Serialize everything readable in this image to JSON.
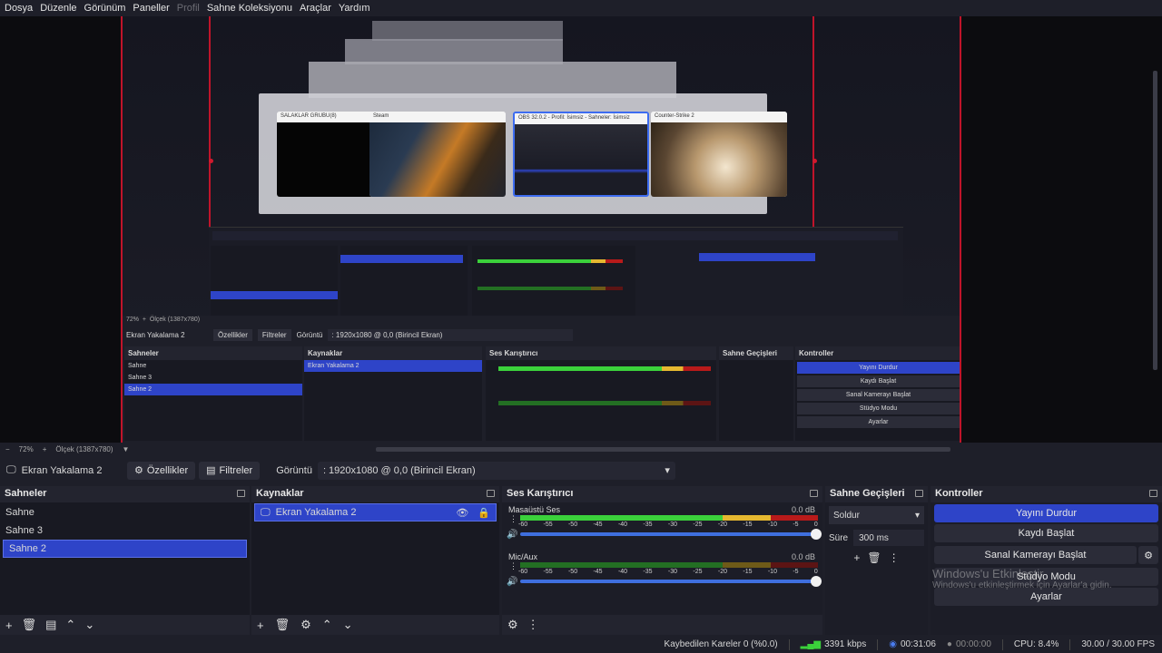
{
  "menu": [
    "Dosya",
    "Düzenle",
    "Görünüm",
    "Paneller",
    "Profil",
    "Sahne Koleksiyonu",
    "Araçlar",
    "Yardım"
  ],
  "preview": {
    "switcher_windows": [
      {
        "title": "SALAKLAR GRUBU(8)"
      },
      {
        "title": "Steam"
      },
      {
        "title": "OBS 32.0.2 - Profil: İsimsiz - Sahneler: İsimsiz"
      },
      {
        "title": "Counter-Strike 2"
      }
    ],
    "mid_obs": {
      "source_name": "Ekran Yakalama 2",
      "props_label": "Özellikler",
      "filters_label": "Filtreler",
      "view_label": "Görüntü",
      "view_value": ": 1920x1080 @ 0,0 (Birincil Ekran)",
      "scenes_title": "Sahneler",
      "scenes": [
        "Sahne",
        "Sahne 3",
        "Sahne 2"
      ],
      "sources_title": "Kaynaklar",
      "mixer_title": "Ses Karıştırıcı",
      "transitions_title": "Sahne Geçişleri",
      "controls_title": "Kontroller",
      "stop_stream": "Yayını Durdur",
      "start_rec": "Kaydı Başlat",
      "virtual_cam": "Sanal Kamerayı Başlat",
      "studio": "Stüdyo Modu",
      "settings": "Ayarlar",
      "zoom": "72%",
      "scale": "Ölçek (1387x780)"
    }
  },
  "toolbar": {
    "zoom": "72%",
    "scale": "Ölçek (1387x780)"
  },
  "source_bar": {
    "name": "Ekran Yakalama 2",
    "props": "Özellikler",
    "filters": "Filtreler",
    "view_label": "Görüntü",
    "view_value": ": 1920x1080 @ 0,0 (Birincil Ekran)"
  },
  "scenes": {
    "title": "Sahneler",
    "items": [
      "Sahne",
      "Sahne 3",
      "Sahne 2"
    ],
    "active_index": 2
  },
  "sources": {
    "title": "Kaynaklar",
    "items": [
      "Ekran Yakalama 2"
    ]
  },
  "mixer": {
    "title": "Ses Karıştırıcı",
    "channels": [
      {
        "name": "Masaüstü Ses",
        "db": "0.0 dB",
        "level": 0.84
      },
      {
        "name": "Mic/Aux",
        "db": "0.0 dB",
        "level": 0.0
      }
    ],
    "ticks": [
      "-60",
      "-55",
      "-50",
      "-45",
      "-40",
      "-35",
      "-30",
      "-25",
      "-20",
      "-15",
      "-10",
      "-5",
      "0"
    ]
  },
  "transitions": {
    "title": "Sahne Geçişleri",
    "type": "Soldur",
    "duration_label": "Süre",
    "duration_value": "300 ms"
  },
  "controls": {
    "title": "Kontroller",
    "stop_stream": "Yayını Durdur",
    "start_rec": "Kaydı Başlat",
    "virtual_cam": "Sanal Kamerayı Başlat",
    "studio": "Stüdyo Modu",
    "settings": "Ayarlar"
  },
  "watermark": {
    "title": "Windows'u Etkinleştir",
    "sub": "Windows'u etkinleştirmek için Ayarlar'a gidin."
  },
  "status": {
    "dropped": "Kaybedilen Kareler 0 (%0.0)",
    "bitrate": "3391 kbps",
    "stream_time": "00:31:06",
    "rec_time": "00:00:00",
    "cpu": "CPU: 8.4%",
    "fps": "30.00 / 30.00 FPS"
  },
  "colors": {
    "accent": "#2e44c8",
    "red_border": "#c0142a",
    "bg": "#1e1f29"
  }
}
